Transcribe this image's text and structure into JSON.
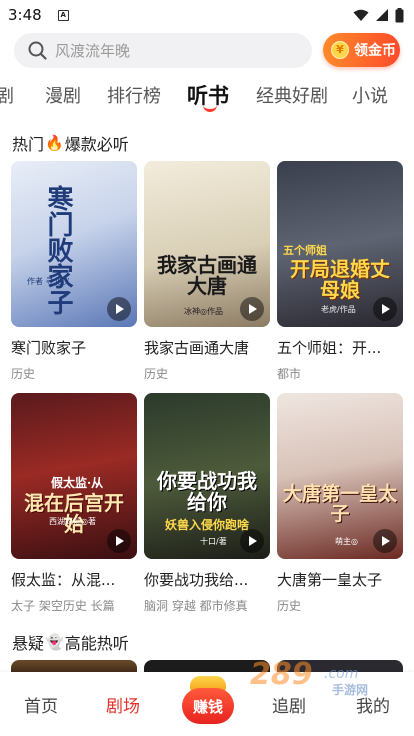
{
  "status_bar": {
    "time": "3:48",
    "notification_letter": "A"
  },
  "search": {
    "placeholder": "风渡流年晚"
  },
  "coin_button": {
    "label": "领金币",
    "icon_glyph": "¥"
  },
  "tabs": [
    {
      "label": "剧",
      "active": false
    },
    {
      "label": "漫剧",
      "active": false
    },
    {
      "label": "排行榜",
      "active": false
    },
    {
      "label": "听书",
      "active": true
    },
    {
      "label": "经典好剧",
      "active": false
    },
    {
      "label": "小说",
      "active": false
    }
  ],
  "section_hot": {
    "before": "热门",
    "glyph": "🔥",
    "after": "爆款必听"
  },
  "section_suspense": {
    "before": "悬疑",
    "glyph": "👻",
    "after": "高能热听"
  },
  "books": [
    {
      "title": "寒门败家子",
      "tags": "历史",
      "cover_text": "寒门败家子",
      "cover_author": "作者 寻北仪"
    },
    {
      "title": "我家古画通大唐",
      "tags": "历史",
      "cover_text": "我家古画通大唐",
      "cover_author": "冰神◎作品"
    },
    {
      "title": "五个师姐：开...",
      "tags": "都市",
      "cover_text": "开局退婚丈母娘",
      "cover_top": "五个师姐",
      "cover_author": "老虎/作品"
    },
    {
      "title": "假太监：从混...",
      "tags": "太子 架空历史 长篇",
      "cover_text": "混在后宫开始",
      "cover_top": "假太监·从",
      "cover_author": "西湖疯仙◎著"
    },
    {
      "title": "你要战功我给...",
      "tags": "脑洞 穿越 都市修真",
      "cover_text": "你要战功我给你",
      "cover_top": "",
      "cover_sub": "妖兽入侵你跑啥",
      "cover_author": "十口/著"
    },
    {
      "title": "大唐第一皇太子",
      "tags": "历史",
      "cover_text": "大唐第一皇太子",
      "cover_author": "萌主◎"
    }
  ],
  "bottom_nav": [
    {
      "label": "首页",
      "active": false
    },
    {
      "label": "剧场",
      "active": true
    },
    {
      "label": "赚钱",
      "active": false
    },
    {
      "label": "追剧",
      "active": false
    },
    {
      "label": "我的",
      "active": false
    }
  ],
  "watermark": {
    "text": "289",
    "sub": "手游网",
    "suffix": ".com"
  },
  "colors": {
    "accent": "#e0322a",
    "coin_start": "#ff8a2a",
    "coin_end": "#ff4b2b"
  }
}
